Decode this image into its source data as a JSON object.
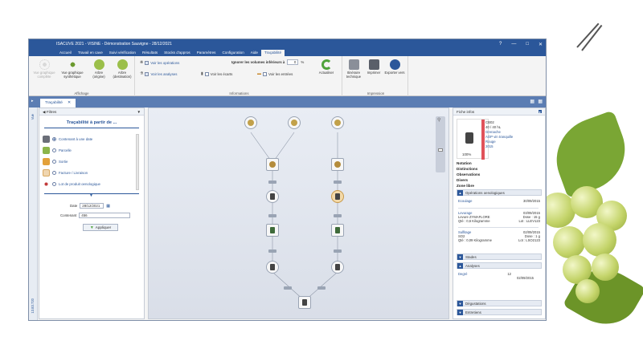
{
  "window": {
    "title": "ISACUVE 2021 - VISINE - Démonstration Sauvigne - 28/12/2021",
    "min_icon": "minimize-icon",
    "max_icon": "maximize-icon",
    "close_icon": "close-icon"
  },
  "menu": [
    "Accueil",
    "Travail en cave",
    "Suivi vérification",
    "Résultats",
    "Stocks d'appros",
    "Paramètres",
    "Configuration",
    "Aide",
    "Traçabilité"
  ],
  "ribbon": {
    "affichage": {
      "label": "Affichage",
      "btn1": "Vue graphique complète",
      "btn2": "Vue graphique synthétique",
      "btn3": "Arbre (origine)",
      "btn4": "Arbre (destination)"
    },
    "informations": {
      "label": "Informations",
      "show_ops": "Voir les opérations",
      "show_analyses": "Voir les analyses",
      "show_gaps": "Voir les écarts",
      "show_entries": "Voir les entrées",
      "ignore_label": "Ignorer les volumes inférieurs à",
      "ignore_value": "0",
      "ignore_unit": "%",
      "refresh": "Actualiser"
    },
    "impression": {
      "label": "Impression",
      "itinerary": "Itinéraire technique",
      "print": "Imprimer",
      "export": "Exporter vers"
    }
  },
  "doctab": "Traçabilité",
  "sidestrip": {
    "top": "Vue",
    "bottom": "13.83.720"
  },
  "filters": {
    "header": "Filtres",
    "title": "Traçabilité à partir de ...",
    "options": [
      "Contenant à une date",
      "Parcelle",
      "Sortie",
      "Facture / Livraison",
      "Lot de produit oenologique"
    ],
    "date_label": "Date",
    "date_value": "28/12/2021",
    "container_label": "Contenant",
    "container_value": "456",
    "apply": "Appliquer"
  },
  "info": {
    "header": "Fiche infos",
    "card": {
      "code": "CB02",
      "volume": "40 / 40 hL",
      "grape": "Grenache",
      "appellation": "AOP vin tranquille",
      "color": "Rouge",
      "year": "2015",
      "percent": "100%"
    },
    "labels": [
      "Notation",
      "Distinctions",
      "Observations",
      "Divers",
      "Zone libre"
    ],
    "ops_section": "Opérations oenologiques",
    "ops": [
      {
        "name": "Ecoulage",
        "date": "30/09/2015"
      },
      {
        "name": "Levurage",
        "date": "03/09/2015",
        "l2a": "Levure ZYMAFLORE",
        "l2b": "Dose : 15 g",
        "l3a": "Qté : 0,6 Kilogramme",
        "l3b": "Lot : LLEV123"
      },
      {
        "name": "Sulfitage",
        "date": "02/09/2015",
        "l2a": "SO2",
        "l2b": "Dose : 1 g",
        "l3a": "Qté : 0,09 Kilogramme",
        "l3b": "Lot : LSO2123"
      }
    ],
    "stades": "Stades",
    "analyses": "Analyses",
    "degre_label": "Degré",
    "degre_value": "12",
    "degre_date": "02/09/2015",
    "degustations": "Dégustations",
    "entretiens": "Entretiens"
  },
  "colors": {
    "brand": "#2b579a",
    "accent_red": "#e0525a"
  }
}
